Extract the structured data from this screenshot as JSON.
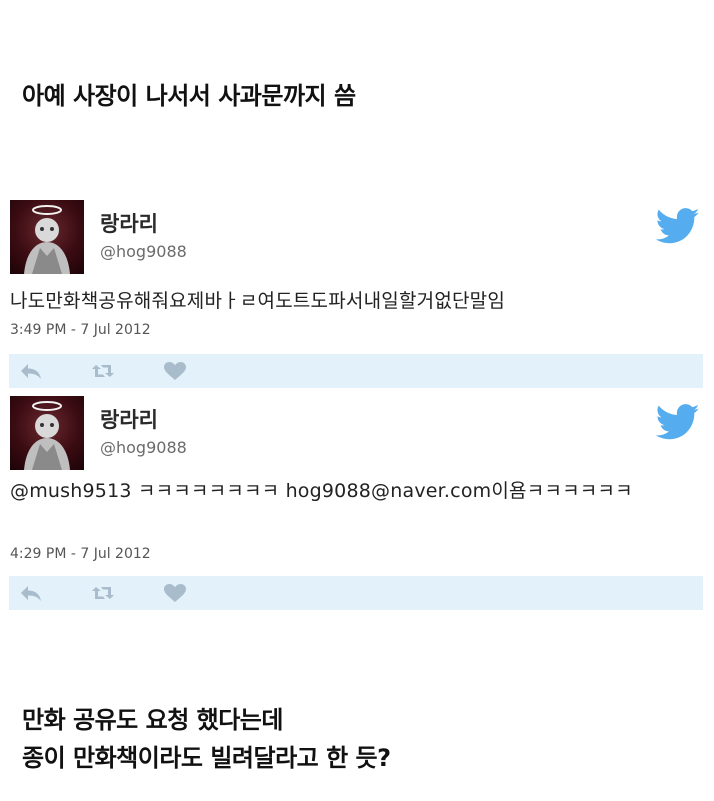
{
  "heading": "아예 사장이 나서서 사과문까지 씀",
  "tweets": [
    {
      "name": "랑라리",
      "handle": "@hog9088",
      "text": "나도만화책공유해줘요제바ㅏㄹ여도트도파서내일할거없단말임",
      "timestamp": "3:49 PM - 7 Jul 2012"
    },
    {
      "name": "랑라리",
      "handle": "@hog9088",
      "text": "@mush9513 ㅋㅋㅋㅋㅋㅋㅋㅋ hog9088@naver.com이욤ㅋㅋㅋㅋㅋㅋ",
      "timestamp": "4:29 PM - 7 Jul 2012"
    }
  ],
  "captions": [
    "만화 공유도 요청 했다는데",
    "종이 만화책이라도 빌려달라고 한 듯?"
  ],
  "icons": {
    "brand": "twitter-bird-icon",
    "reply": "reply-icon",
    "retweet": "retweet-icon",
    "like": "heart-icon"
  },
  "colors": {
    "twitter_blue": "#55acee",
    "action_bar": "#e3f1fa",
    "action_icon": "#a8bccb"
  }
}
